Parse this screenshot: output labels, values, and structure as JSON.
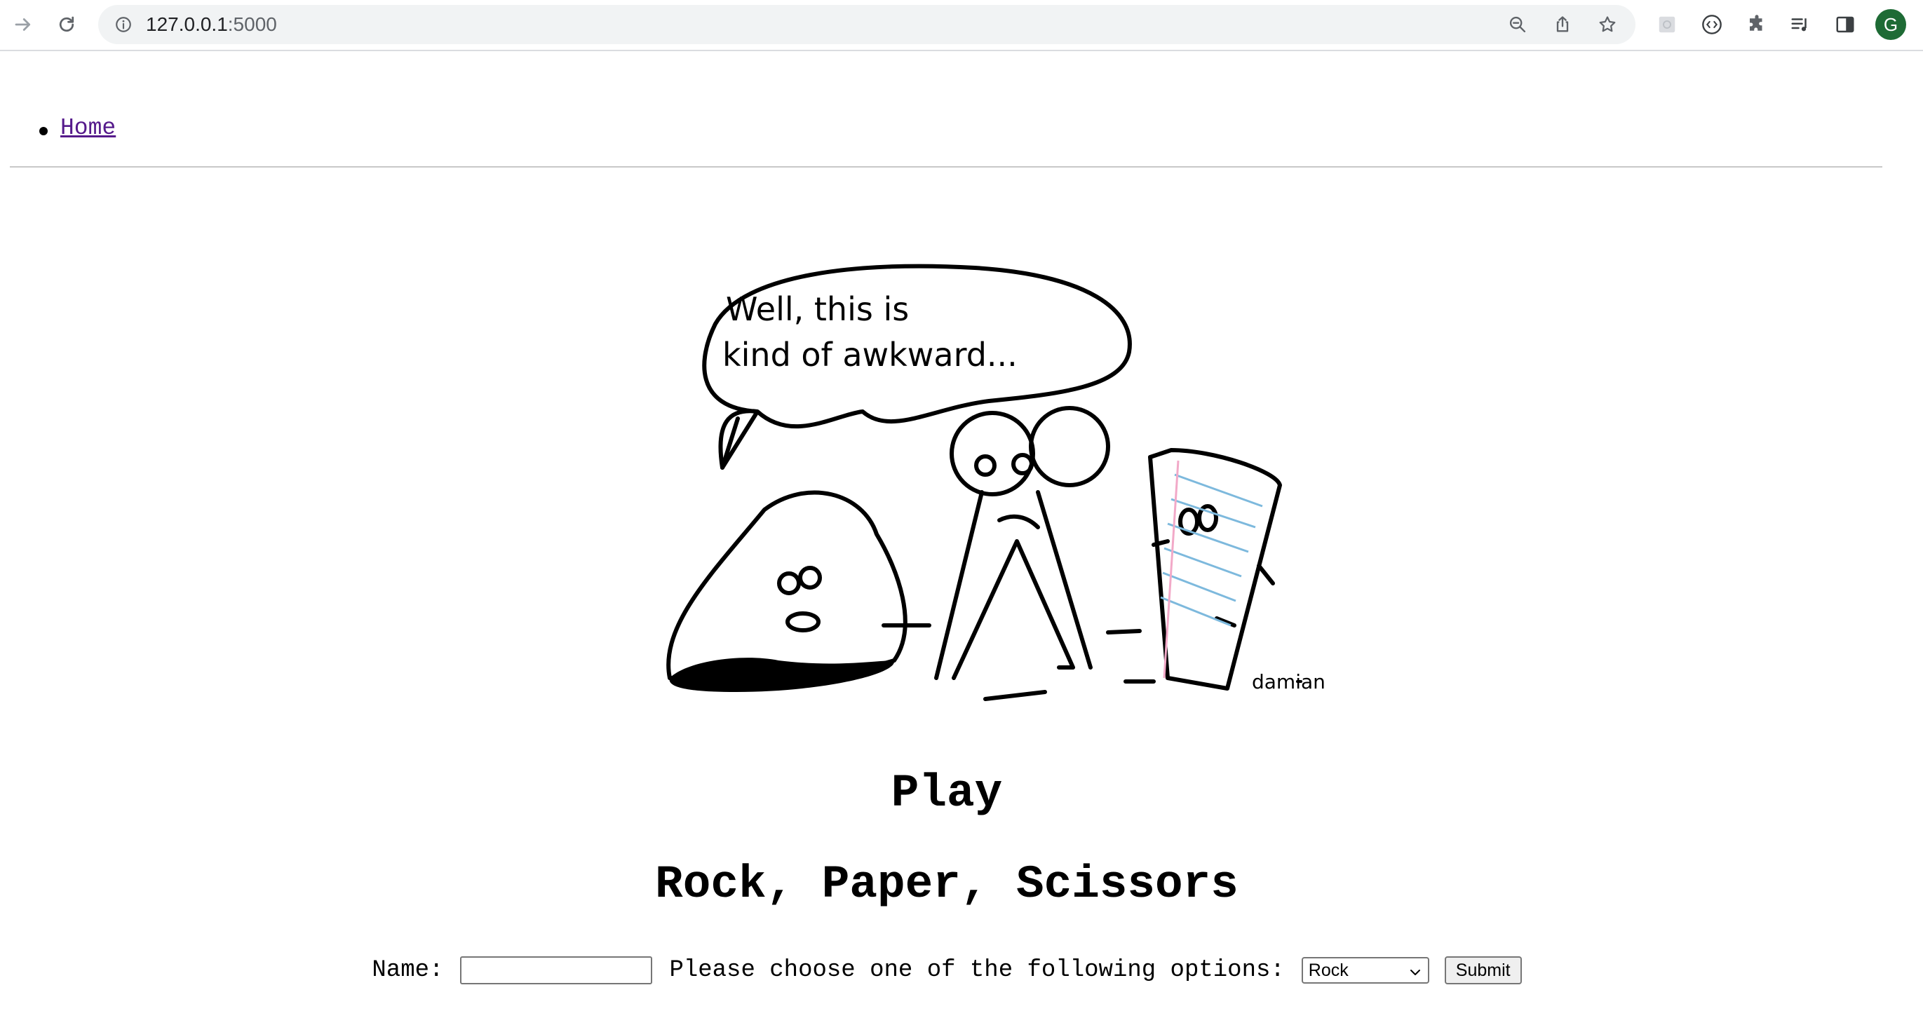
{
  "browser": {
    "url_host": "127.0.0.1",
    "url_port": ":5000",
    "profile_initial": "G"
  },
  "nav": {
    "items": [
      {
        "label": "Home"
      }
    ]
  },
  "cartoon": {
    "speech_line1": "Well, this is",
    "speech_line2": "kind of awkward...",
    "signature": "damian"
  },
  "main": {
    "heading": "Play",
    "subheading": "Rock, Paper, Scissors"
  },
  "form": {
    "name_label": "Name:",
    "name_value": "",
    "choose_label": "Please choose one of the following options:",
    "selected_option": "Rock",
    "submit_label": "Submit"
  }
}
